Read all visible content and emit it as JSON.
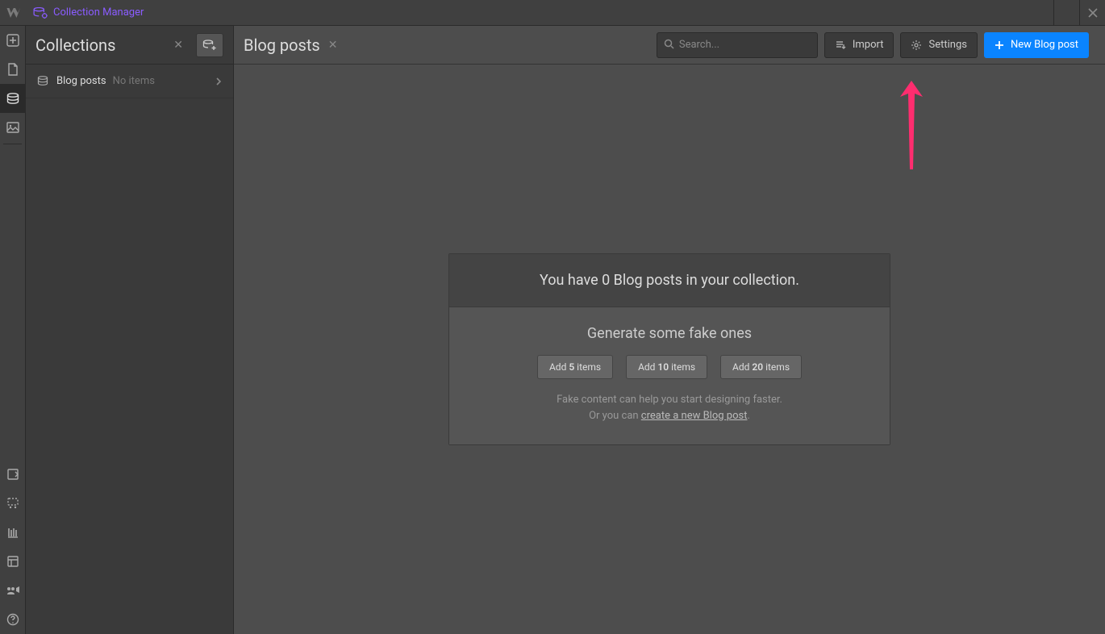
{
  "topbar": {
    "title": "Collection Manager"
  },
  "sidebar": {
    "title": "Collections",
    "items": [
      {
        "name": "Blog posts",
        "count_text": "No items"
      }
    ]
  },
  "content": {
    "title": "Blog posts",
    "search_placeholder": "Search...",
    "buttons": {
      "import": "Import",
      "settings": "Settings",
      "new": "New Blog post"
    },
    "empty": {
      "headline": "You have 0 Blog posts in your collection.",
      "subtitle": "Generate some fake ones",
      "gen_buttons": [
        {
          "prefix": "Add ",
          "count": "5",
          "suffix": " items"
        },
        {
          "prefix": "Add ",
          "count": "10",
          "suffix": " items"
        },
        {
          "prefix": "Add ",
          "count": "20",
          "suffix": " items"
        }
      ],
      "note1": "Fake content can help you start designing faster.",
      "note2a": "Or you can ",
      "note2_link": "create a new Blog post",
      "note2b": "."
    }
  },
  "colors": {
    "accent": "#0a84ff",
    "purple": "#8a5cff",
    "annotation": "#ff2d6f"
  }
}
